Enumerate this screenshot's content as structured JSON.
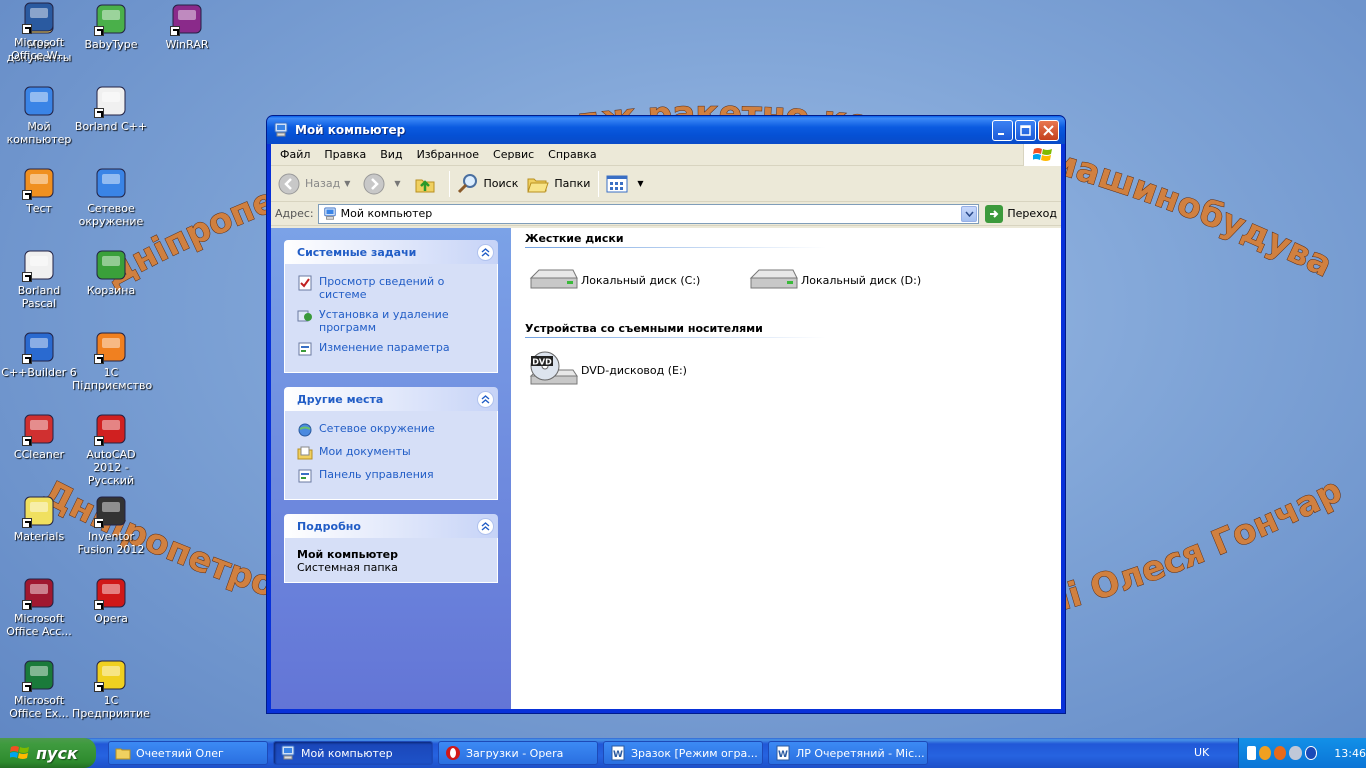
{
  "wallpaper": {
    "arc_top": "Дніпропетровський коледж ракетно-космічного машинобудування",
    "arc_bottom": "Дніпропетровського національного університету імені Олеся Гончара"
  },
  "desktop_icons": [
    {
      "name": "my-documents",
      "label": "Мои документы"
    },
    {
      "name": "babytype",
      "label": "BabyType"
    },
    {
      "name": "winrar",
      "label": "WinRAR"
    },
    {
      "name": "my-computer",
      "label": "Мой компьютер"
    },
    {
      "name": "borland-cpp",
      "label": "Borland C++"
    },
    {
      "name": "test",
      "label": "Тест"
    },
    {
      "name": "network",
      "label": "Сетевое окружение"
    },
    {
      "name": "borland-pascal",
      "label": "Borland Pascal"
    },
    {
      "name": "recycle-bin",
      "label": "Корзина"
    },
    {
      "name": "cppbuilder",
      "label": "C++Builder 6"
    },
    {
      "name": "1c-ua",
      "label": "1С Підприємство"
    },
    {
      "name": "ccleaner",
      "label": "CCleaner"
    },
    {
      "name": "autocad",
      "label": "AutoCAD 2012 - Русский"
    },
    {
      "name": "materials",
      "label": "Materials"
    },
    {
      "name": "inventor",
      "label": "Inventor Fusion 2012"
    },
    {
      "name": "ms-access",
      "label": "Microsoft Office Acc..."
    },
    {
      "name": "opera",
      "label": "Opera"
    },
    {
      "name": "ms-excel",
      "label": "Microsoft Office Ex..."
    },
    {
      "name": "1c-ru",
      "label": "1С Предприятие"
    },
    {
      "name": "ms-word",
      "label": "Microsoft Office W..."
    }
  ],
  "window": {
    "title": "Мой компьютер",
    "menu": [
      "Файл",
      "Правка",
      "Вид",
      "Избранное",
      "Сервис",
      "Справка"
    ],
    "toolbar": {
      "back": "Назад",
      "search": "Поиск",
      "folders": "Папки"
    },
    "address": {
      "label": "Адрес:",
      "value": "Мой компьютер",
      "go": "Переход"
    },
    "taskpane": {
      "system_tasks": {
        "title": "Системные задачи",
        "items": [
          "Просмотр сведений о системе",
          "Установка и удаление программ",
          "Изменение параметра"
        ]
      },
      "other_places": {
        "title": "Другие места",
        "items": [
          "Сетевое окружение",
          "Мои документы",
          "Панель управления"
        ]
      },
      "details": {
        "title": "Подробно",
        "name": "Мой компьютер",
        "type": "Системная папка"
      }
    },
    "groups": {
      "hard_disks": {
        "title": "Жесткие диски",
        "items": [
          "Локальный диск (C:)",
          "Локальный диск (D:)"
        ]
      },
      "removable": {
        "title": "Устройства со съемными носителями",
        "items": [
          "DVD-дисковод (E:)"
        ]
      }
    }
  },
  "taskbar": {
    "start": "пуск",
    "tasks": [
      {
        "label": "Очеетяий Олег",
        "active": false
      },
      {
        "label": "Мой компьютер",
        "active": true
      },
      {
        "label": "Загрузки - Opera",
        "active": false
      },
      {
        "label": "Зразок [Режим огра...",
        "active": false
      },
      {
        "label": "ЛР Очеретяний - Mic...",
        "active": false
      }
    ],
    "language": "UK",
    "clock": "13:46"
  },
  "colors": {
    "xp_blue": "#0831d9",
    "link_blue": "#215dc6",
    "start_green": "#3f9b3f"
  }
}
